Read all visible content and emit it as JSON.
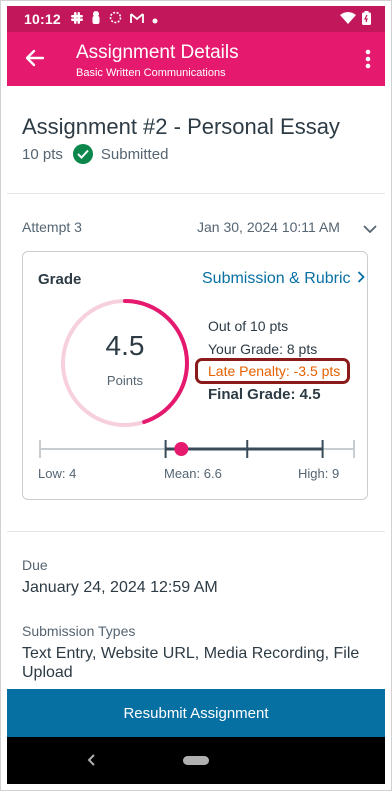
{
  "status_bar": {
    "time": "10:12",
    "icons": [
      "slack-icon",
      "person-icon",
      "sync-icon",
      "gmail-icon",
      "dot-icon"
    ],
    "right_icons": [
      "wifi-icon",
      "battery-icon"
    ]
  },
  "app_bar": {
    "title": "Assignment Details",
    "subtitle": "Basic Written Communications"
  },
  "assignment": {
    "title": "Assignment #2 - Personal Essay",
    "points": "10 pts",
    "status": "Submitted"
  },
  "attempt": {
    "label": "Attempt 3",
    "date": "Jan 30, 2024 10:11 AM"
  },
  "grade": {
    "label": "Grade",
    "link": "Submission & Rubric",
    "score": "4.5",
    "score_unit": "Points",
    "score_fraction": 0.45,
    "out_of": "Out of 10 pts",
    "your_grade": "Your Grade: 8 pts",
    "late_penalty": "Late Penalty: -3.5 pts",
    "final_grade": "Final Grade: 4.5"
  },
  "distribution": {
    "low_label": "Low: 4",
    "mean_label": "Mean: 6.6",
    "high_label": "High: 9",
    "low": 4,
    "mean": 6.6,
    "high": 9,
    "score": 4.5,
    "max": 10
  },
  "details": {
    "due_label": "Due",
    "due_value": "January 24, 2024 12:59 AM",
    "types_label": "Submission Types",
    "types_value": "Text Entry, Website URL, Media Recording, File Upload"
  },
  "footer": {
    "resubmit_label": "Resubmit Assignment"
  },
  "colors": {
    "app_bar": "#e5196e",
    "status_bar": "#c2185b",
    "ring": "#e5196e",
    "link": "#0770a3",
    "late": "#e66000",
    "success": "#0b874b",
    "button": "#0770a3"
  }
}
